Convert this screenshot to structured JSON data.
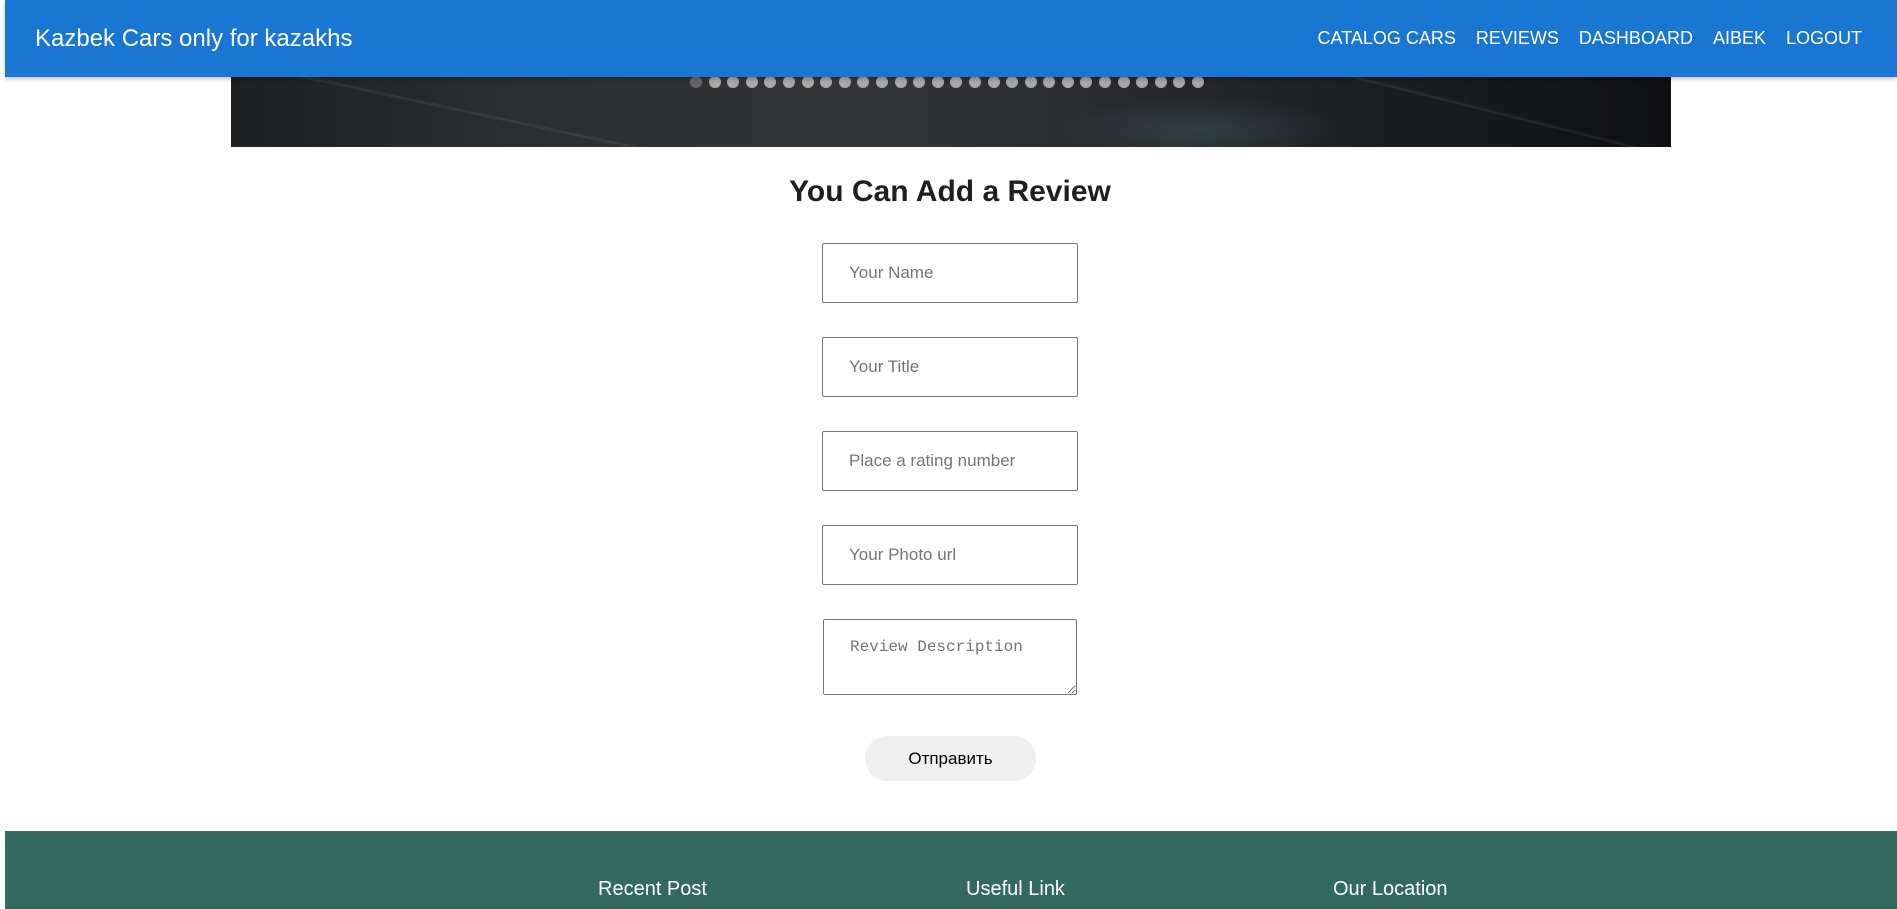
{
  "header": {
    "brand": "Kazbek Cars only for kazakhs",
    "nav": [
      "CATALOG CARS",
      "REVIEWS",
      "DASHBOARD",
      "AIBEK",
      "LOGOUT"
    ]
  },
  "carousel": {
    "slide_count": 28,
    "active_index": 0
  },
  "review_form": {
    "title": "You Can Add a Review",
    "name_placeholder": "Your Name",
    "title_placeholder": "Your Title",
    "rating_placeholder": "Place a rating number",
    "photo_placeholder": "Your Photo url",
    "description_placeholder": "Review Description",
    "submit_label": "Отправить"
  },
  "footer": {
    "headings": [
      "Recent Post",
      "Useful Link",
      "Our Location"
    ]
  },
  "colors": {
    "header": "#1976d2",
    "footer": "#336a5f"
  }
}
